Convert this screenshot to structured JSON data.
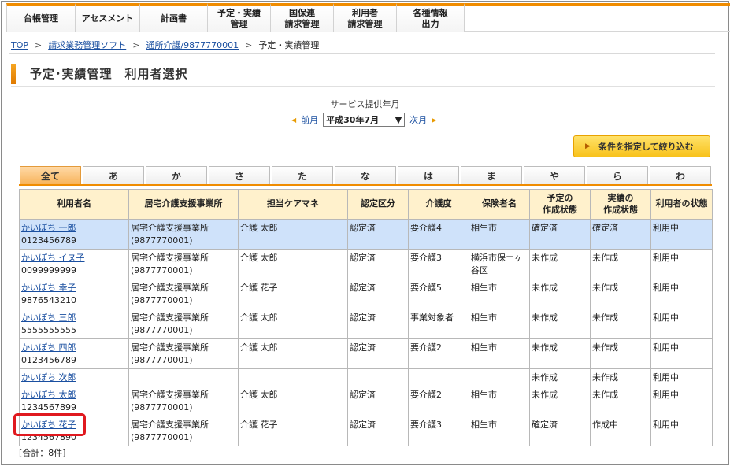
{
  "nav": {
    "items": [
      {
        "label": "台帳管理",
        "width": 88
      },
      {
        "label": "アセスメント",
        "width": 82
      },
      {
        "label": "計画書",
        "width": 86
      },
      {
        "label": "予定・実績\n管理",
        "width": 80
      },
      {
        "label": "国保連\n請求管理",
        "width": 80
      },
      {
        "label": "利用者\n請求管理",
        "width": 80
      },
      {
        "label": "各種情報\n出力",
        "width": 86
      }
    ]
  },
  "breadcrumb": {
    "top": "TOP",
    "sep": ">",
    "software": "請求業務管理ソフト",
    "office": "通所介護/9877770001",
    "current": "予定・実績管理"
  },
  "page": {
    "title": "予定･実績管理　利用者選択"
  },
  "service_month": {
    "label": "サービス提供年月",
    "prev": "前月",
    "next": "次月",
    "selected": "平成30年7月"
  },
  "filter_button": "条件を指定して絞り込む",
  "tabs": [
    "全て",
    "あ",
    "か",
    "さ",
    "た",
    "な",
    "は",
    "ま",
    "や",
    "ら",
    "わ"
  ],
  "table": {
    "headers": [
      "利用者名",
      "居宅介護支援事業所",
      "担当ケアマネ",
      "認定区分",
      "介護度",
      "保険者名",
      "予定の\n作成状態",
      "実績の\n作成状態",
      "利用者の状態"
    ],
    "rows": [
      {
        "name": "かいぽち 一郎",
        "id": "0123456789",
        "office": "居宅介護支援事業所",
        "office_no": "(9877770001)",
        "manager": "介護 太郎",
        "cert": "認定済",
        "level": "要介護4",
        "insurer": "相生市",
        "plan": "確定済",
        "actual": "確定済",
        "status": "利用中",
        "selected": true
      },
      {
        "name": "かいぽち イヌ子",
        "id": "0099999999",
        "office": "居宅介護支援事業所",
        "office_no": "(9877770001)",
        "manager": "介護 太郎",
        "cert": "認定済",
        "level": "要介護3",
        "insurer": "横浜市保土ヶ谷区",
        "plan": "未作成",
        "actual": "未作成",
        "status": "利用中"
      },
      {
        "name": "かいぽち 幸子",
        "id": "9876543210",
        "office": "居宅介護支援事業所",
        "office_no": "(9877770001)",
        "manager": "介護 花子",
        "cert": "認定済",
        "level": "要介護5",
        "insurer": "相生市",
        "plan": "未作成",
        "actual": "未作成",
        "status": "利用中"
      },
      {
        "name": "かいぽち 三郎",
        "id": "5555555555",
        "office": "居宅介護支援事業所",
        "office_no": "(9877770001)",
        "manager": "介護 太郎",
        "cert": "認定済",
        "level": "事業対象者",
        "insurer": "相生市",
        "plan": "未作成",
        "actual": "未作成",
        "status": "利用中"
      },
      {
        "name": "かいぽち 四郎",
        "id": "0123456789",
        "office": "居宅介護支援事業所",
        "office_no": "(9877770001)",
        "manager": "介護 太郎",
        "cert": "認定済",
        "level": "要介護2",
        "insurer": "相生市",
        "plan": "未作成",
        "actual": "未作成",
        "status": "利用中"
      },
      {
        "name": "かいぽち 次郎",
        "id": "",
        "office": "",
        "office_no": "",
        "manager": "",
        "cert": "",
        "level": "",
        "insurer": "",
        "plan": "未作成",
        "actual": "未作成",
        "status": "利用中",
        "short": true
      },
      {
        "name": "かいぽち 太郎",
        "id": "1234567899",
        "office": "居宅介護支援事業所",
        "office_no": "(9877770001)",
        "manager": "介護 太郎",
        "cert": "認定済",
        "level": "要介護2",
        "insurer": "相生市",
        "plan": "未作成",
        "actual": "未作成",
        "status": "利用中"
      },
      {
        "name": "かいぽち 花子",
        "id": "1234567890",
        "office": "居宅介護支援事業所",
        "office_no": "(9877770001)",
        "manager": "介護 花子",
        "cert": "認定済",
        "level": "要介護3",
        "insurer": "相生市",
        "plan": "確定済",
        "actual": "作成中",
        "status": "利用中"
      }
    ]
  },
  "total": "[合計：8件]",
  "colors": {
    "accent": "#f08c00",
    "header_bg": "#fff1cc",
    "selected_row": "#cfe2fa",
    "highlight": "#e0191f"
  }
}
